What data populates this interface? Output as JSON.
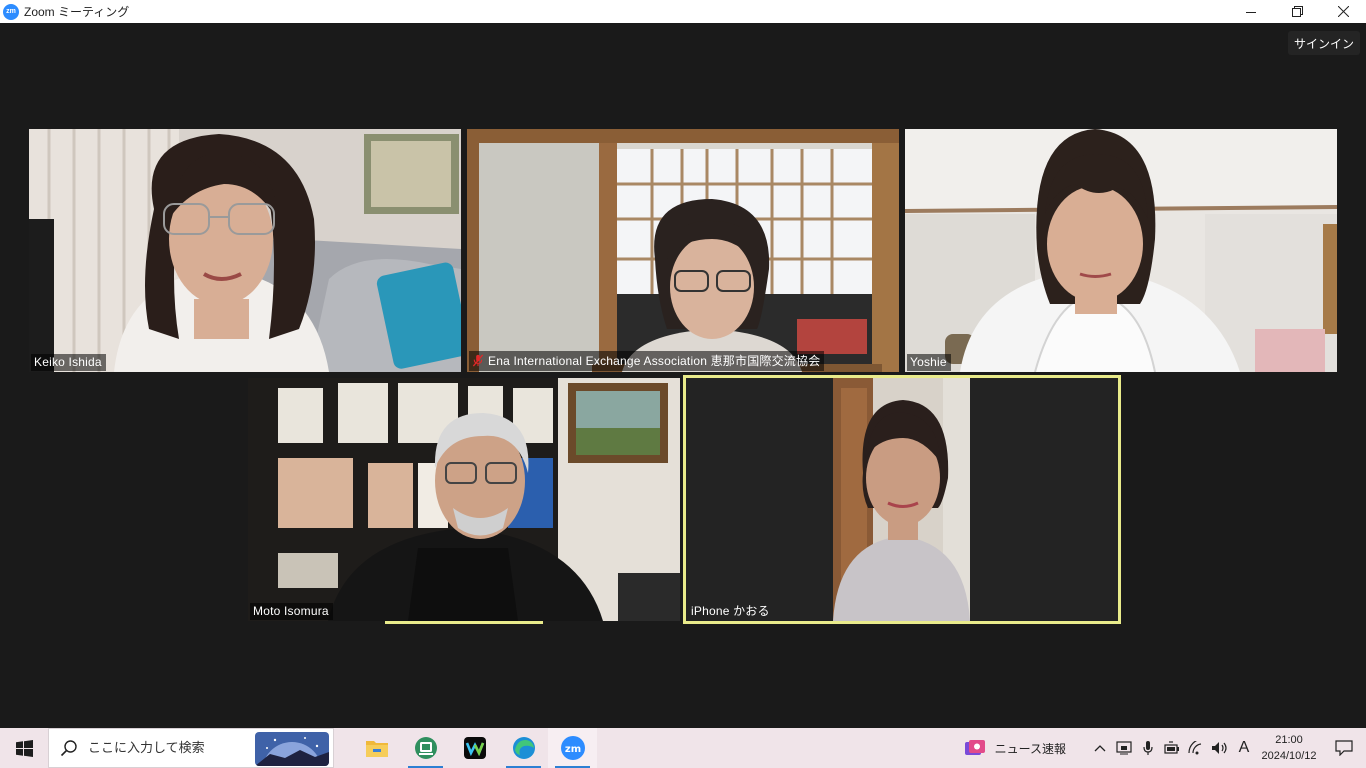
{
  "window": {
    "title": "Zoom ミーティング",
    "logo_text": "zm",
    "controls": [
      "minimize-icon",
      "restore-icon",
      "close-icon"
    ]
  },
  "meeting": {
    "signin_label": "サインイン",
    "participants": [
      {
        "name": "Keiko Ishida",
        "muted": false,
        "active": false
      },
      {
        "name": "Ena International Exchange Association 恵那市国際交流協会",
        "muted": true,
        "active": false
      },
      {
        "name": "Yoshie",
        "muted": false,
        "active": false
      },
      {
        "name": "Moto Isomura",
        "muted": false,
        "active": false
      },
      {
        "name": "iPhone かおる",
        "muted": false,
        "active": true
      }
    ],
    "colors": {
      "background": "#1a1a1a",
      "active_speaker": "#e9eb8b",
      "muted": "#e02828"
    }
  },
  "taskbar": {
    "search_placeholder": "ここに入力して検索",
    "apps": [
      {
        "icon": "file-explorer-icon",
        "running": false
      },
      {
        "icon": "app-icon",
        "running": true
      },
      {
        "icon": "webex-icon",
        "running": false
      },
      {
        "icon": "edge-icon",
        "running": true
      },
      {
        "icon": "zoom-icon",
        "running": true,
        "active": true
      }
    ],
    "news_label": "ニュース速報",
    "tray_icons": [
      "chevron-up-icon",
      "network-monitor-icon",
      "microphone-icon",
      "battery-icon",
      "wifi-icon",
      "volume-icon"
    ],
    "ime": "A",
    "time": "21:00",
    "date": "2024/10/12",
    "accent": "#2d7fd3"
  }
}
